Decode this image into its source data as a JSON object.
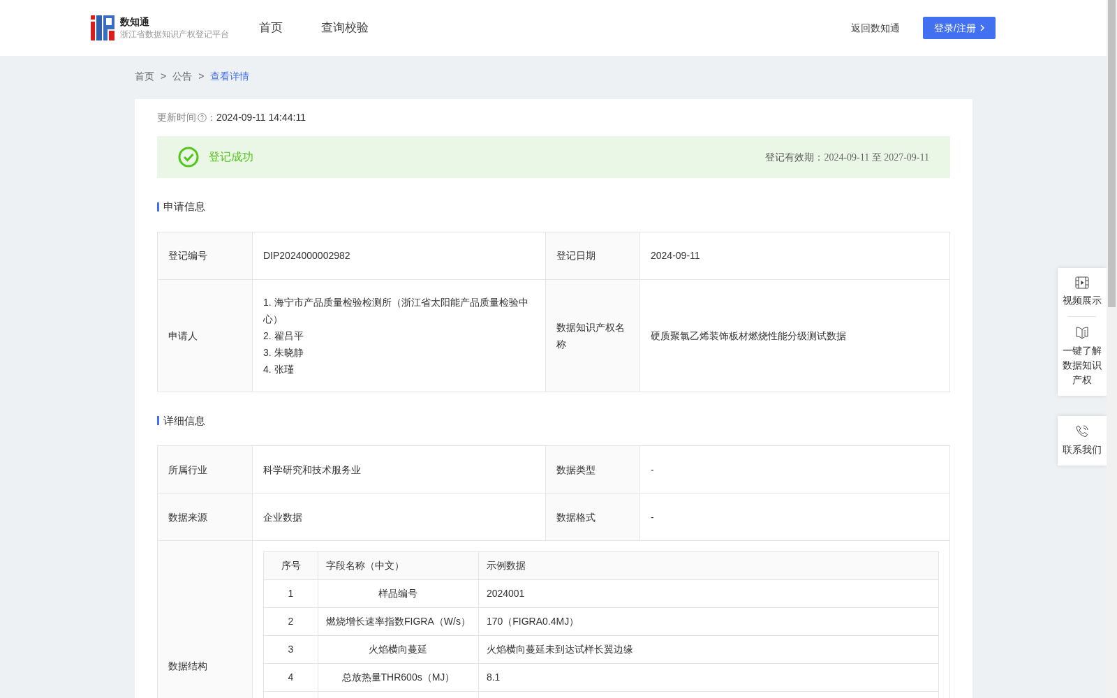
{
  "header": {
    "brand": "数知通",
    "subtitle": "浙江省数据知识产权登记平台",
    "nav": [
      {
        "label": "首页",
        "selected": false
      },
      {
        "label": "查询校验",
        "selected": false
      }
    ],
    "back_link": "返回数知通",
    "login_button": "登录/注册"
  },
  "breadcrumb": [
    {
      "label": "首页",
      "selected": false
    },
    {
      "label": "公告",
      "selected": false
    },
    {
      "label": "查看详情",
      "selected": true
    }
  ],
  "breadcrumb_separator": ">",
  "updated": {
    "label": "更新时间",
    "separator": "：",
    "value": "2024-09-11 14:44:11"
  },
  "status": {
    "kind": "success",
    "label": "登记成功",
    "validity_label": "登记有效期：",
    "validity_value": "2024-09-11 至 2027-09-11"
  },
  "sections": [
    {
      "title": "申请信息",
      "rows": [
        {
          "cells": [
            {
              "label": "登记编号",
              "value": [
                "DIP2024000002982"
              ]
            },
            {
              "label": "登记日期",
              "value": [
                "2024-09-11"
              ]
            }
          ]
        },
        {
          "cells": [
            {
              "label": "申请人",
              "value": [
                "1. 海宁市产品质量检验检测所（浙江省太阳能产品质量检验中心）",
                "2. 翟吕平",
                "3. 朱晓静",
                "4. 张瑾"
              ]
            },
            {
              "label": "数据知识产权名称",
              "value": [
                "硬质聚氯乙烯装饰板材燃烧性能分级测试数据"
              ]
            }
          ]
        }
      ]
    },
    {
      "title": "详细信息",
      "rows": [
        {
          "cells": [
            {
              "label": "所属行业",
              "value": [
                "科学研究和技术服务业"
              ]
            },
            {
              "label": "数据类型",
              "value": [
                "-"
              ]
            }
          ]
        },
        {
          "cells": [
            {
              "label": "数据来源",
              "value": [
                "企业数据"
              ]
            },
            {
              "label": "数据格式",
              "value": [
                "-"
              ]
            }
          ]
        }
      ],
      "structure": {
        "label": "数据结构",
        "columns": [
          "序号",
          "字段名称（中文）",
          "示例数据"
        ],
        "rows": [
          [
            "1",
            "样品编号",
            "2024001"
          ],
          [
            "2",
            "燃烧增长速率指数FIGRA（W/s）",
            "170（FIGRA0.4MJ）"
          ],
          [
            "3",
            "火焰横向蔓延",
            "火焰横向蔓延未到达试样长翼边缘"
          ],
          [
            "4",
            "总放热量THR600s（MJ）",
            "8.1"
          ]
        ]
      }
    }
  ],
  "side_panel": [
    {
      "kind": "video",
      "label": "视频展示"
    },
    {
      "kind": "book",
      "label": "一键了解数据知识产权"
    },
    {
      "kind": "phone",
      "label": "联系我们"
    }
  ]
}
